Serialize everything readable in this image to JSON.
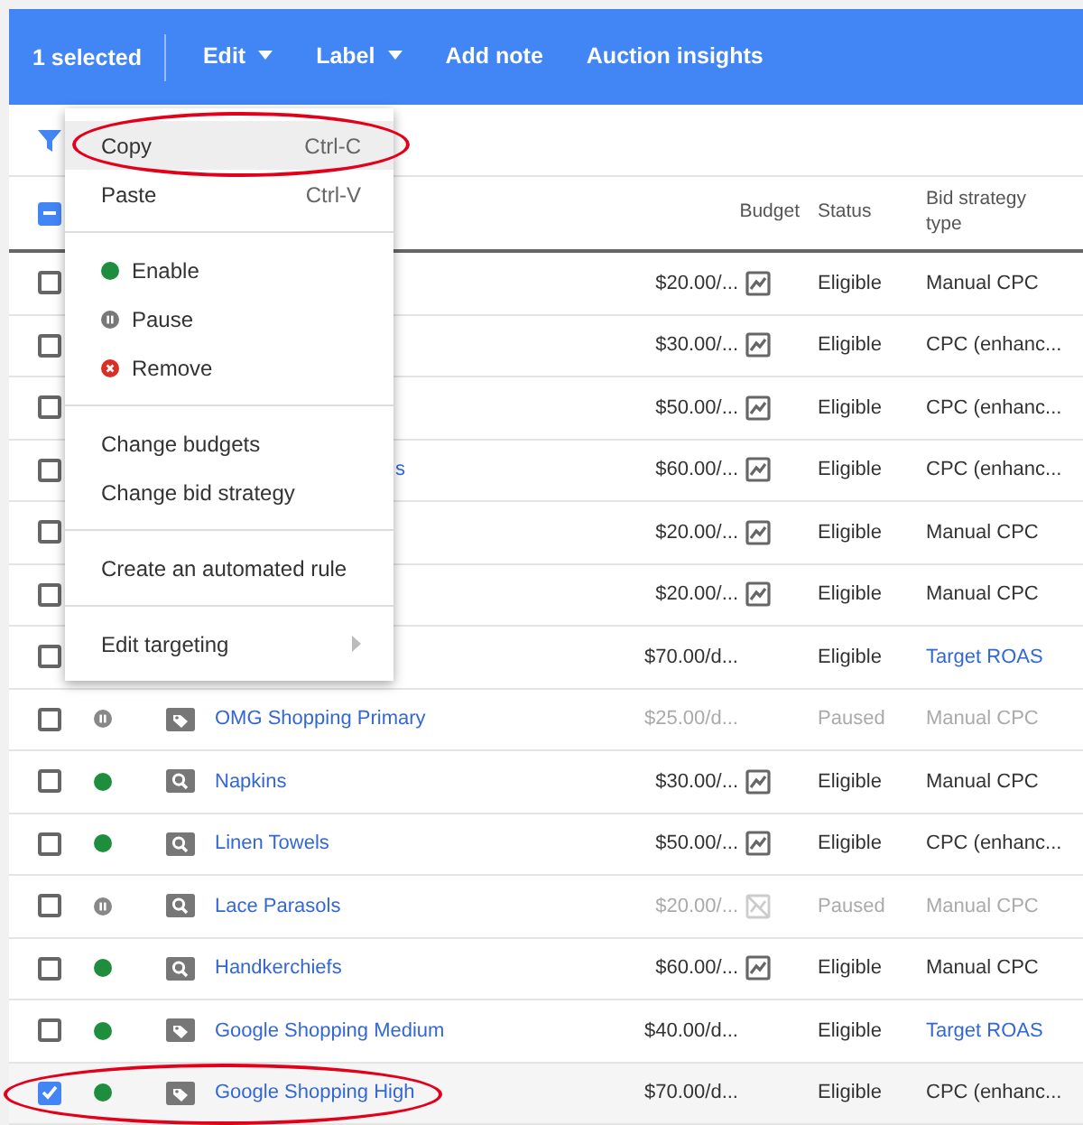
{
  "toolbar": {
    "selection": "1 selected",
    "actions": [
      {
        "label": "Edit",
        "dropdown": true
      },
      {
        "label": "Label",
        "dropdown": true
      },
      {
        "label": "Add note",
        "dropdown": false
      },
      {
        "label": "Auction insights",
        "dropdown": false
      }
    ]
  },
  "table": {
    "select_all": {
      "mixed": true
    },
    "columns": [
      {
        "label": "Budget"
      },
      {
        "label": "Status"
      },
      {
        "label": "Bid strategy type"
      }
    ],
    "rows": [
      {
        "checked": false,
        "paused": false,
        "budget": "$20.00/...",
        "chart": true,
        "status": "Eligible",
        "bid": "Manual CPC",
        "bid_link": false
      },
      {
        "checked": false,
        "paused": false,
        "budget": "$30.00/...",
        "chart": true,
        "status": "Eligible",
        "bid": "CPC (enhanc...",
        "bid_link": false
      },
      {
        "checked": false,
        "paused": false,
        "budget": "$50.00/...",
        "chart": true,
        "status": "Eligible",
        "bid": "CPC (enhanc...",
        "bid_link": false
      },
      {
        "checked": false,
        "paused": false,
        "name": "s",
        "covered": true,
        "budget": "$60.00/...",
        "chart": true,
        "status": "Eligible",
        "bid": "CPC (enhanc...",
        "bid_link": false
      },
      {
        "checked": false,
        "paused": false,
        "budget": "$20.00/...",
        "chart": true,
        "status": "Eligible",
        "bid": "Manual CPC",
        "bid_link": false
      },
      {
        "checked": false,
        "paused": false,
        "budget": "$20.00/...",
        "chart": true,
        "status": "Eligible",
        "bid": "Manual CPC",
        "bid_link": false
      },
      {
        "checked": false,
        "paused": false,
        "budget": "$70.00/d...",
        "chart": false,
        "status": "Eligible",
        "bid": "Target ROAS",
        "bid_link": true
      },
      {
        "checked": false,
        "paused": true,
        "kind": "shopping",
        "name": "OMG Shopping Primary",
        "budget": "$25.00/d...",
        "chart": false,
        "status": "Paused",
        "bid": "Manual CPC",
        "bid_link": false
      },
      {
        "checked": false,
        "paused": false,
        "kind": "search",
        "name": "Napkins",
        "budget": "$30.00/...",
        "chart": true,
        "status": "Eligible",
        "bid": "Manual CPC",
        "bid_link": false
      },
      {
        "checked": false,
        "paused": false,
        "kind": "search",
        "name": "Linen Towels",
        "budget": "$50.00/...",
        "chart": true,
        "status": "Eligible",
        "bid": "CPC (enhanc...",
        "bid_link": false
      },
      {
        "checked": false,
        "paused": true,
        "kind": "search",
        "name": "Lace Parasols",
        "budget": "$20.00/...",
        "chart": true,
        "status": "Paused",
        "bid": "Manual CPC",
        "bid_link": false
      },
      {
        "checked": false,
        "paused": false,
        "kind": "search",
        "name": "Handkerchiefs",
        "budget": "$60.00/...",
        "chart": true,
        "status": "Eligible",
        "bid": "Manual CPC",
        "bid_link": false
      },
      {
        "checked": false,
        "paused": false,
        "kind": "shopping",
        "name": "Google Shopping Medium",
        "budget": "$40.00/d...",
        "chart": false,
        "status": "Eligible",
        "bid": "Target ROAS",
        "bid_link": true
      },
      {
        "checked": true,
        "paused": false,
        "kind": "shopping",
        "name": "Google Shopping High",
        "budget": "$70.00/d...",
        "chart": false,
        "status": "Eligible",
        "bid": "CPC (enhanc...",
        "bid_link": false,
        "circled": true
      }
    ]
  },
  "menu": {
    "groups": [
      [
        {
          "label": "Copy",
          "shortcut": "Ctrl-C",
          "highlighted": true,
          "circled": true
        },
        {
          "label": "Paste",
          "shortcut": "Ctrl-V",
          "highlighted": false
        }
      ],
      [
        {
          "label": "Enable",
          "kind": "enable",
          "highlighted": false
        },
        {
          "label": "Pause",
          "kind": "pause",
          "highlighted": false
        },
        {
          "label": "Remove",
          "kind": "remove",
          "highlighted": false
        }
      ],
      [
        {
          "label": "Change budgets",
          "highlighted": false
        },
        {
          "label": "Change bid strategy",
          "highlighted": false
        }
      ],
      [
        {
          "label": "Create an automated rule",
          "highlighted": false
        }
      ],
      [
        {
          "label": "Edit targeting",
          "submenu": true,
          "highlighted": false
        }
      ]
    ]
  }
}
